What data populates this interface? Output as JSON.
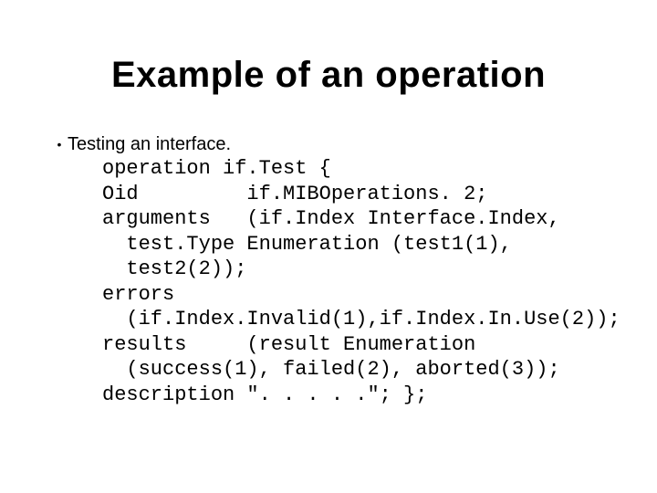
{
  "slide": {
    "title": "Example of an operation",
    "bullet": "Testing an interface.",
    "code_lines": [
      "operation if.Test {",
      "Oid         if.MIBOperations. 2;",
      "arguments   (if.Index Interface.Index,",
      "  test.Type Enumeration (test1(1),",
      "  test2(2));",
      "errors",
      "  (if.Index.Invalid(1),if.Index.In.Use(2));",
      "results     (result Enumeration",
      "  (success(1), failed(2), aborted(3));",
      "description \". . . . .\"; };"
    ]
  }
}
